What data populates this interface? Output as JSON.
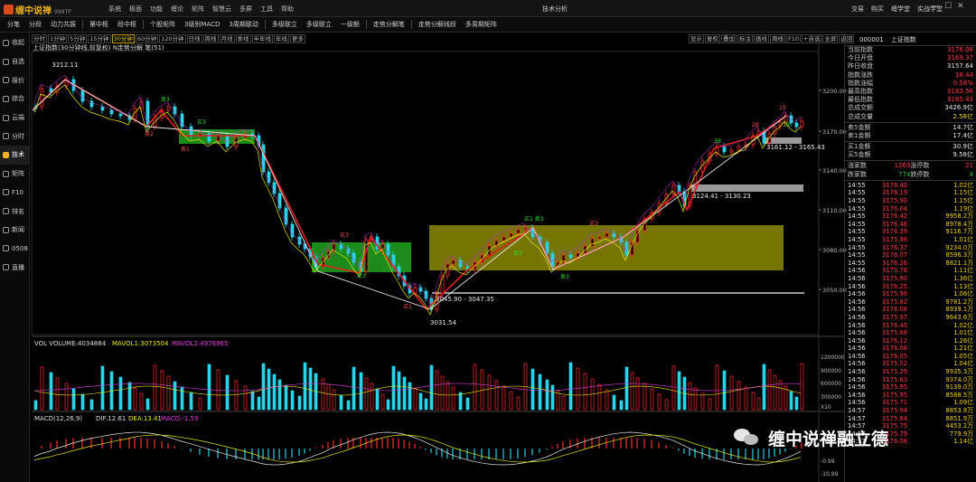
{
  "app": {
    "logo": "缠中说禅",
    "version": "999TP",
    "window_title": "技术分析",
    "menu": [
      "系统",
      "板面",
      "功能",
      "缠论",
      "矩阵",
      "智慧云",
      "多屏",
      "工具",
      "帮助"
    ],
    "right_menu": [
      "交易",
      "购买",
      "缠学堂",
      "实战学堂"
    ],
    "win_controls": [
      "—",
      "☐",
      "✕"
    ]
  },
  "toolbar": [
    "分笔",
    "分段",
    "动力共振",
    "第中枢",
    "段中枢",
    "个股矩阵",
    "3级别MACD",
    "3周期联动",
    "多级联立",
    "多级联立",
    "一级额",
    "走势分解笔",
    "走势分解线段",
    "多周期矩阵"
  ],
  "sidebar": [
    {
      "label": "收起",
      "icon": "collapse-icon"
    },
    {
      "label": "自选",
      "icon": "star-icon"
    },
    {
      "label": "报价",
      "icon": "quote-icon"
    },
    {
      "label": "综合",
      "icon": "grid-icon"
    },
    {
      "label": "云端",
      "icon": "cloud-icon"
    },
    {
      "label": "分时",
      "icon": "clock-icon"
    },
    {
      "label": "技术",
      "icon": "kline-icon",
      "active": true
    },
    {
      "label": "矩阵",
      "icon": "matrix-icon"
    },
    {
      "label": "F10",
      "icon": "info-icon"
    },
    {
      "label": "排名",
      "icon": "rank-icon"
    },
    {
      "label": "新闻",
      "icon": "news-icon"
    },
    {
      "label": "0508",
      "icon": "code-icon"
    },
    {
      "label": "直播",
      "icon": "live-icon"
    }
  ],
  "periods": {
    "items": [
      "分时",
      "1分钟",
      "5分钟",
      "15分钟",
      "30分钟",
      "60分钟",
      "120分钟",
      "日线",
      "周线",
      "月线",
      "季线",
      "半年线",
      "年线",
      "更多"
    ],
    "active": "30分钟"
  },
  "controls": [
    "显示",
    "复权",
    "叠加",
    "标注",
    "画线",
    "周线",
    "F10",
    "+自选",
    "全屏",
    "返回"
  ],
  "chart": {
    "header": "上证指数(30分钟线,前复权) N走势分解 笔(51)",
    "price_axis": [
      "3200.00",
      "3170.00",
      "3140.00",
      "3110.00",
      "3080.00",
      "3050.00"
    ],
    "annotations": [
      {
        "text": "3212.11",
        "color": "#e8e8e8"
      },
      {
        "text": "3031.54",
        "color": "#e8e8e8"
      },
      {
        "text": "3045.90 - 3047.35",
        "color": "#e8e8e8"
      },
      {
        "text": "3124.41 - 3130.23",
        "color": "#e8e8e8"
      },
      {
        "text": "3161.12 - 3165.43",
        "color": "#e8e8e8"
      }
    ],
    "buy_sell_marks": [
      "卖3",
      "卖2",
      "买3",
      "卖1",
      "买1 卖3",
      "买3",
      "卖3",
      "买1",
      "卖3",
      "买3",
      "卖3",
      "1S",
      "1B",
      "2B",
      "3B"
    ]
  },
  "volume": {
    "label": "VOL VOLUME:4034884",
    "ma1": "MAVOL1:3073504",
    "ma2": "MAVOL2:4976965",
    "axis": [
      "1200000",
      "900000",
      "600000",
      "300000"
    ],
    "unit": "X10"
  },
  "macd": {
    "label": "MACD(12,26,9)",
    "dif": "DIF:12.61",
    "dea": "DEA:13.41",
    "macd": "MACD:-1.59",
    "axis": [
      "-0.99",
      "-10.99"
    ]
  },
  "quote": {
    "code": "000001",
    "name": "上证指数",
    "stats": [
      {
        "k": "当前指数",
        "v": "3176.08",
        "c": "red"
      },
      {
        "k": "今日开盘",
        "v": "3169.37",
        "c": "red"
      },
      {
        "k": "昨日收盘",
        "v": "3157.64",
        "c": "wht"
      },
      {
        "k": "指数涨跌",
        "v": "18.44",
        "c": "red"
      },
      {
        "k": "指数涨幅",
        "v": "0.58%",
        "c": "red"
      },
      {
        "k": "最高指数",
        "v": "3183.56",
        "c": "red"
      },
      {
        "k": "最低指数",
        "v": "3165.43",
        "c": "red"
      },
      {
        "k": "总成交额",
        "v": "3426.9亿",
        "c": "wht"
      },
      {
        "k": "总成交量",
        "v": "2.58亿",
        "c": "yel"
      },
      {
        "k": "卖5金额",
        "v": "14.7亿",
        "c": "wht"
      },
      {
        "k": "卖1金额",
        "v": "17.4亿",
        "c": "wht"
      },
      {
        "k": "买1金额",
        "v": "30.9亿",
        "c": "wht"
      },
      {
        "k": "买5金额",
        "v": "9.58亿",
        "c": "wht"
      }
    ],
    "breadth": [
      {
        "k1": "涨家数",
        "v1": "1263",
        "c1": "red",
        "k2": "涨停数",
        "v2": "21",
        "c2": "red"
      },
      {
        "k1": "跌家数",
        "v1": "774",
        "c1": "grn",
        "k2": "跌停数",
        "v2": "4",
        "c2": "grn"
      }
    ],
    "ticks": [
      {
        "t": "14:55",
        "p": "3176.40",
        "v": "1.02亿",
        "c": "red"
      },
      {
        "t": "14:55",
        "p": "3176.19",
        "v": "1.15亿",
        "c": "red"
      },
      {
        "t": "14:55",
        "p": "3175.90",
        "v": "1.15亿",
        "c": "red"
      },
      {
        "t": "14:55",
        "p": "3176.04",
        "v": "1.19亿",
        "c": "red"
      },
      {
        "t": "14:55",
        "p": "3176.42",
        "v": "9958.2万",
        "c": "red"
      },
      {
        "t": "14:55",
        "p": "3176.48",
        "v": "8978.4万",
        "c": "red"
      },
      {
        "t": "14:55",
        "p": "3176.39",
        "v": "9116.7万",
        "c": "red"
      },
      {
        "t": "14:55",
        "p": "3175.96",
        "v": "1.01亿",
        "c": "red"
      },
      {
        "t": "14:55",
        "p": "3176.37",
        "v": "9234.0万",
        "c": "red"
      },
      {
        "t": "14:55",
        "p": "3176.07",
        "v": "8596.3万",
        "c": "red"
      },
      {
        "t": "14:55",
        "p": "3176.26",
        "v": "8821.1万",
        "c": "red"
      },
      {
        "t": "14:56",
        "p": "3175.76",
        "v": "1.11亿",
        "c": "red"
      },
      {
        "t": "14:56",
        "p": "3175.90",
        "v": "1.36亿",
        "c": "red"
      },
      {
        "t": "14:56",
        "p": "3176.25",
        "v": "1.13亿",
        "c": "red"
      },
      {
        "t": "14:56",
        "p": "3175.96",
        "v": "1.06亿",
        "c": "red"
      },
      {
        "t": "14:56",
        "p": "3175.82",
        "v": "9781.2万",
        "c": "red"
      },
      {
        "t": "14:56",
        "p": "3176.08",
        "v": "8939.1万",
        "c": "red"
      },
      {
        "t": "14:56",
        "p": "3175.97",
        "v": "9643.6万",
        "c": "red"
      },
      {
        "t": "14:56",
        "p": "3176.40",
        "v": "1.02亿",
        "c": "red"
      },
      {
        "t": "14:56",
        "p": "3175.66",
        "v": "1.01亿",
        "c": "red"
      },
      {
        "t": "14:56",
        "p": "3176.12",
        "v": "1.26亿",
        "c": "red"
      },
      {
        "t": "14:56",
        "p": "3176.08",
        "v": "1.21亿",
        "c": "red"
      },
      {
        "t": "14:56",
        "p": "3176.05",
        "v": "1.05亿",
        "c": "red"
      },
      {
        "t": "14:56",
        "p": "3175.52",
        "v": "1.04亿",
        "c": "red"
      },
      {
        "t": "14:56",
        "p": "3175.29",
        "v": "9935.3万",
        "c": "red"
      },
      {
        "t": "14:56",
        "p": "3175.63",
        "v": "9374.0万",
        "c": "red"
      },
      {
        "t": "14:56",
        "p": "3175.95",
        "v": "9139.0万",
        "c": "red"
      },
      {
        "t": "14:56",
        "p": "3175.95",
        "v": "8588.5万",
        "c": "red"
      },
      {
        "t": "14:56",
        "p": "3175.71",
        "v": "1.09亿",
        "c": "red"
      },
      {
        "t": "14:57",
        "p": "3175.94",
        "v": "8853.8万",
        "c": "red"
      },
      {
        "t": "14:57",
        "p": "3175.84",
        "v": "8851.9万",
        "c": "red"
      },
      {
        "t": "14:57",
        "p": "3175.75",
        "v": "4453.2万",
        "c": "red"
      },
      {
        "t": "14:57",
        "p": "3175.79",
        "v": "779.9万",
        "c": "red"
      },
      {
        "t": "14:57",
        "p": "3176.08",
        "v": "1.14亿",
        "c": "red"
      }
    ]
  },
  "watermark": "缠中说禅融立德"
}
